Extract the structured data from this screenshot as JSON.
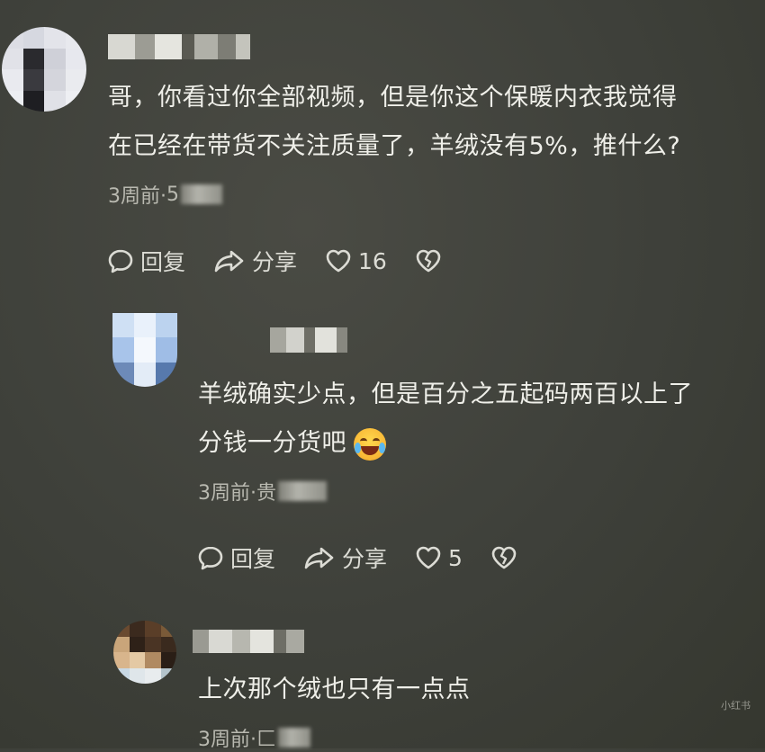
{
  "comments": [
    {
      "text_lines": [
        "哥，你看过你全部视频，但是你这个保暖内衣我觉得",
        "在已经在带货不关注质量了，羊绒没有5%，推什么?"
      ],
      "time": "3周前·",
      "time_suffix": "5",
      "actions": {
        "reply": "回复",
        "share": "分享",
        "likes": "16"
      }
    },
    {
      "text_lines": [
        "羊绒确实少点，但是百分之五起码两百以上了",
        "分钱一分货吧"
      ],
      "emoji": "joy-tears-emoji",
      "time": "3周前·",
      "time_suffix": "贵",
      "actions": {
        "reply": "回复",
        "share": "分享",
        "likes": "5"
      }
    },
    {
      "text_lines": [
        "上次那个绒也只有一点点"
      ],
      "time": "3周前·",
      "time_suffix": "匚"
    }
  ],
  "icons": {
    "reply": "comment-bubble-icon",
    "share": "share-arrow-icon",
    "like": "heart-icon",
    "dislike": "broken-heart-icon"
  },
  "colors": {
    "background": "#3e403a",
    "text": "#efefe9",
    "meta": "#b9b9b0"
  },
  "watermark": "小红书"
}
